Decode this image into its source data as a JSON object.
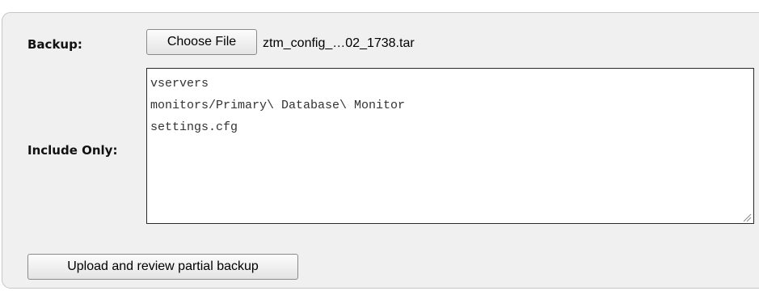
{
  "form": {
    "backup_label": "Backup:",
    "choose_file_label": "Choose File",
    "selected_file": "ztm_config_…02_1738.tar",
    "include_only_label": "Include Only:",
    "include_only_value": "vservers\nmonitors/Primary\\ Database\\ Monitor\nsettings.cfg",
    "submit_label": "Upload and review partial backup"
  },
  "icons": {
    "resize_grip": "resize-grip-icon"
  }
}
